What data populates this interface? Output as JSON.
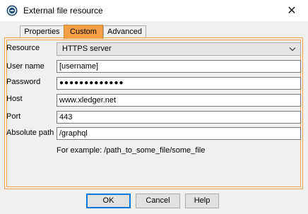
{
  "window": {
    "title": "External file resource",
    "close_glyph": "✕"
  },
  "tabs": [
    {
      "label": "Properties",
      "active": false
    },
    {
      "label": "Custom",
      "active": true
    },
    {
      "label": "Advanced",
      "active": false
    }
  ],
  "form": {
    "resource": {
      "label": "Resource",
      "value": "HTTPS server"
    },
    "username": {
      "label": "User name",
      "value": "[username]"
    },
    "password": {
      "label": "Password",
      "value": "●●●●●●●●●●●●●"
    },
    "host": {
      "label": "Host",
      "value": "www.xledger.net"
    },
    "port": {
      "label": "Port",
      "value": "443"
    },
    "path": {
      "label": "Absolute path",
      "value": "/graphql"
    },
    "hint": "For example: /path_to_some_file/some_file"
  },
  "buttons": {
    "ok": "OK",
    "cancel": "Cancel",
    "help": "Help"
  },
  "colors": {
    "active_tab": "#f6a045",
    "frame_border": "#f5a44d",
    "focus": "#0078d7"
  },
  "icons": {
    "app": "app-icon",
    "close": "close-icon",
    "dropdown": "chevron-down-icon"
  }
}
